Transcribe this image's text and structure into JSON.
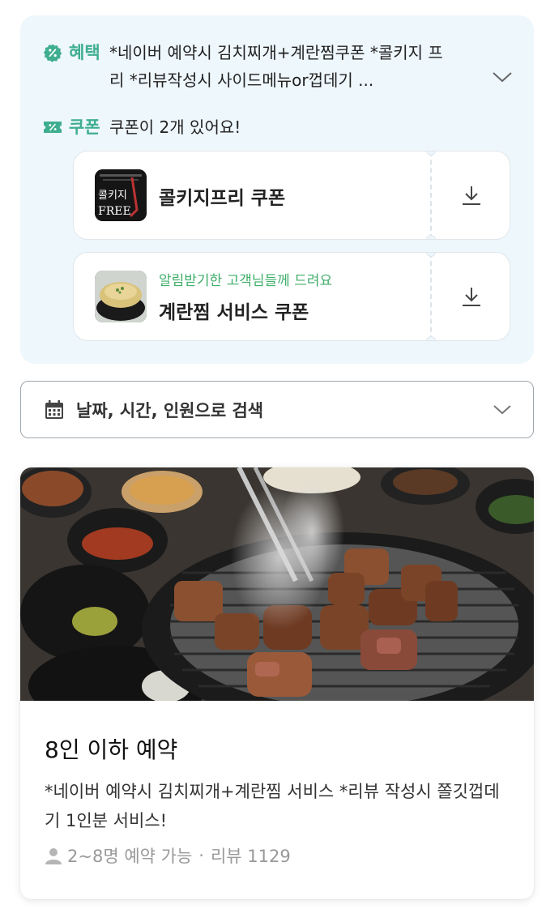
{
  "benefit": {
    "label": "혜택",
    "text": "*네이버 예약시 김치찌개+계란찜쿠폰 *콜키지 프리 *리뷰작성시 사이드메뉴or껍데기 ..."
  },
  "coupon": {
    "label": "쿠폰",
    "count_text": "쿠폰이 2개 있어요!",
    "items": [
      {
        "name": "콜키지프리 쿠폰",
        "subtitle": "",
        "thumb_text": "콜키지\nFREE"
      },
      {
        "name": "계란찜 서비스 쿠폰",
        "subtitle": "알림받기한 고객님들께 드려요"
      }
    ]
  },
  "search": {
    "label": "날짜, 시간, 인원으로 검색"
  },
  "product": {
    "title": "8인 이하 예약",
    "description": "*네이버 예약시 김치찌개+계란찜 서비스 *리뷰 작성시 쫄깃껍데기 1인분 서비스!",
    "capacity": "2~8명 예약 가능",
    "dot": "·",
    "reviews": "리뷰 1129"
  },
  "colors": {
    "accent_green": "#3fae8f",
    "box_bg": "#eef7fc"
  },
  "icons": {
    "benefit": "percent-badge-icon",
    "coupon": "coupon-ticket-icon",
    "download": "download-icon",
    "calendar": "calendar-icon",
    "chevron": "chevron-down-icon",
    "person": "person-icon"
  }
}
